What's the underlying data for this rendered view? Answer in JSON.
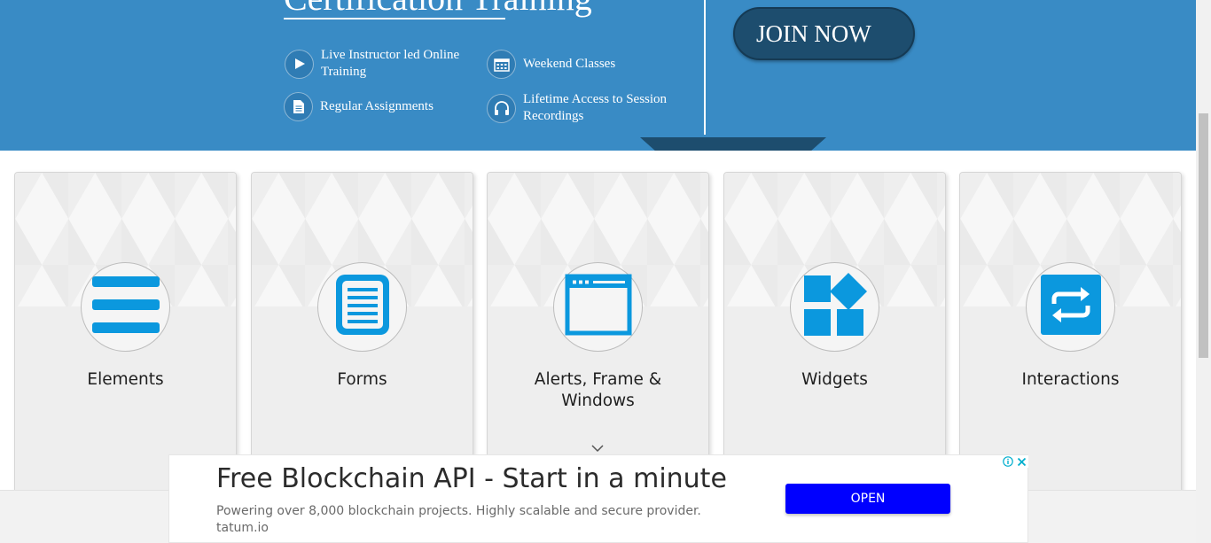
{
  "banner": {
    "title": "Certification Training",
    "join_label": "JOIN NOW",
    "features": [
      {
        "icon": "play-icon",
        "text": "Live Instructor led Online Training"
      },
      {
        "icon": "calendar-icon",
        "text": "Weekend Classes"
      },
      {
        "icon": "document-icon",
        "text": "Regular Assignments"
      },
      {
        "icon": "headphones-icon",
        "text": "Lifetime Access to Session Recordings"
      }
    ],
    "colors": {
      "background": "#398bc5",
      "button": "#1d4d6e"
    }
  },
  "cards": [
    {
      "icon": "menu-lines-icon",
      "label": "Elements"
    },
    {
      "icon": "form-document-icon",
      "label": "Forms"
    },
    {
      "icon": "browser-window-icon",
      "label": "Alerts, Frame & Windows"
    },
    {
      "icon": "widgets-blocks-icon",
      "label": "Widgets"
    },
    {
      "icon": "swap-arrows-icon",
      "label": "Interactions"
    }
  ],
  "card_icon_color": "#0b98de",
  "ad": {
    "headline": "Free Blockchain API - Start in a minute",
    "description": "Powering over 8,000 blockchain projects. Highly scalable and secure provider.",
    "domain": "tatum.io",
    "cta_label": "OPEN",
    "cta_color": "#0000ff",
    "info_icon": "info-icon",
    "close_icon": "close-icon"
  }
}
